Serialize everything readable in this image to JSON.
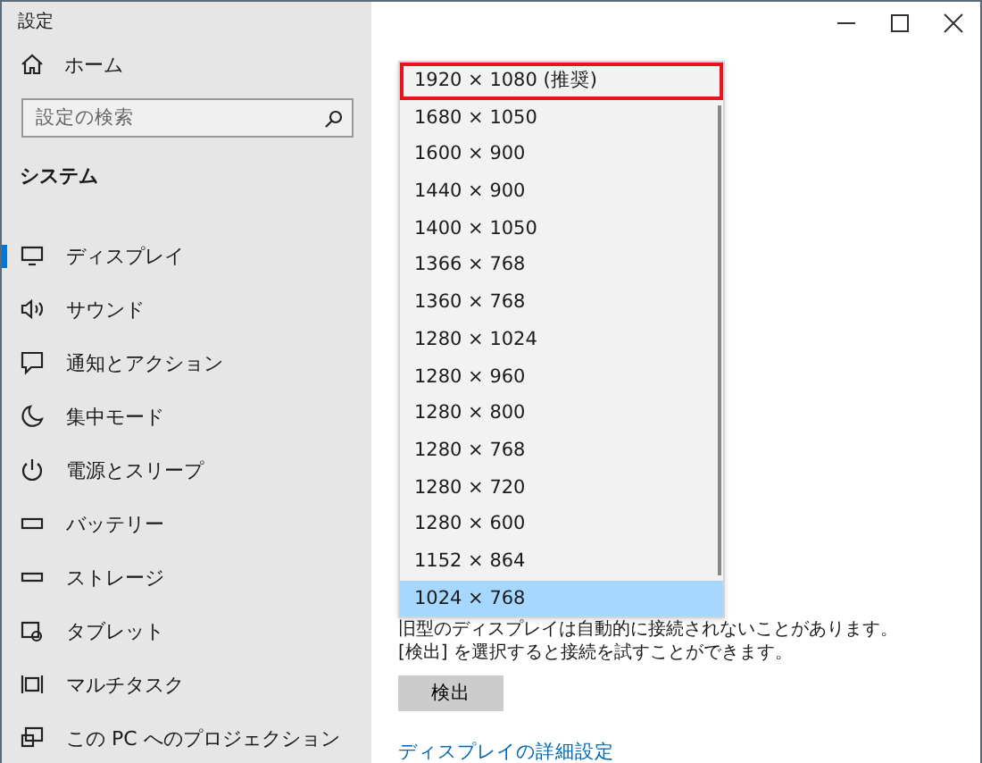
{
  "window": {
    "title": "設定",
    "controls": [
      {
        "kind": "minimize"
      },
      {
        "kind": "maximize"
      },
      {
        "kind": "close"
      }
    ]
  },
  "sidebar": {
    "home": "ホーム",
    "search": {
      "placeholder": "設定の検索"
    },
    "section": "システム",
    "items": [
      {
        "label": "ディスプレイ",
        "selected": true
      },
      {
        "label": "サウンド",
        "selected": false
      },
      {
        "label": "通知とアクション",
        "selected": false
      },
      {
        "label": "集中モード",
        "selected": false
      },
      {
        "label": "電源とスリープ",
        "selected": false
      },
      {
        "label": "バッテリー",
        "selected": false
      },
      {
        "label": "ストレージ",
        "selected": false
      },
      {
        "label": "タブレット",
        "selected": false
      },
      {
        "label": "マルチタスク",
        "selected": false
      },
      {
        "label": "この PC へのプロジェクション",
        "selected": false
      }
    ]
  },
  "resolution_list": {
    "options": [
      {
        "label": "1920 × 1080 (推奨)",
        "selected": false,
        "highlighted": true
      },
      {
        "label": "1680 × 1050",
        "selected": false,
        "highlighted": false
      },
      {
        "label": "1600 × 900",
        "selected": false,
        "highlighted": false
      },
      {
        "label": "1440 × 900",
        "selected": false,
        "highlighted": false
      },
      {
        "label": "1400 × 1050",
        "selected": false,
        "highlighted": false
      },
      {
        "label": "1366 × 768",
        "selected": false,
        "highlighted": false
      },
      {
        "label": "1360 × 768",
        "selected": false,
        "highlighted": false
      },
      {
        "label": "1280 × 1024",
        "selected": false,
        "highlighted": false
      },
      {
        "label": "1280 × 960",
        "selected": false,
        "highlighted": false
      },
      {
        "label": "1280 × 800",
        "selected": false,
        "highlighted": false
      },
      {
        "label": "1280 × 768",
        "selected": false,
        "highlighted": false
      },
      {
        "label": "1280 × 720",
        "selected": false,
        "highlighted": false
      },
      {
        "label": "1280 × 600",
        "selected": false,
        "highlighted": false
      },
      {
        "label": "1152 × 864",
        "selected": false,
        "highlighted": false
      },
      {
        "label": "1024 × 768",
        "selected": true,
        "highlighted": false
      }
    ]
  },
  "content": {
    "description": "旧型のディスプレイは自動的に接続されないことがあります。[検出] を選択すると接続を試すことができます。",
    "detect_button": "検出",
    "advanced_link": "ディスプレイの詳細設定"
  }
}
